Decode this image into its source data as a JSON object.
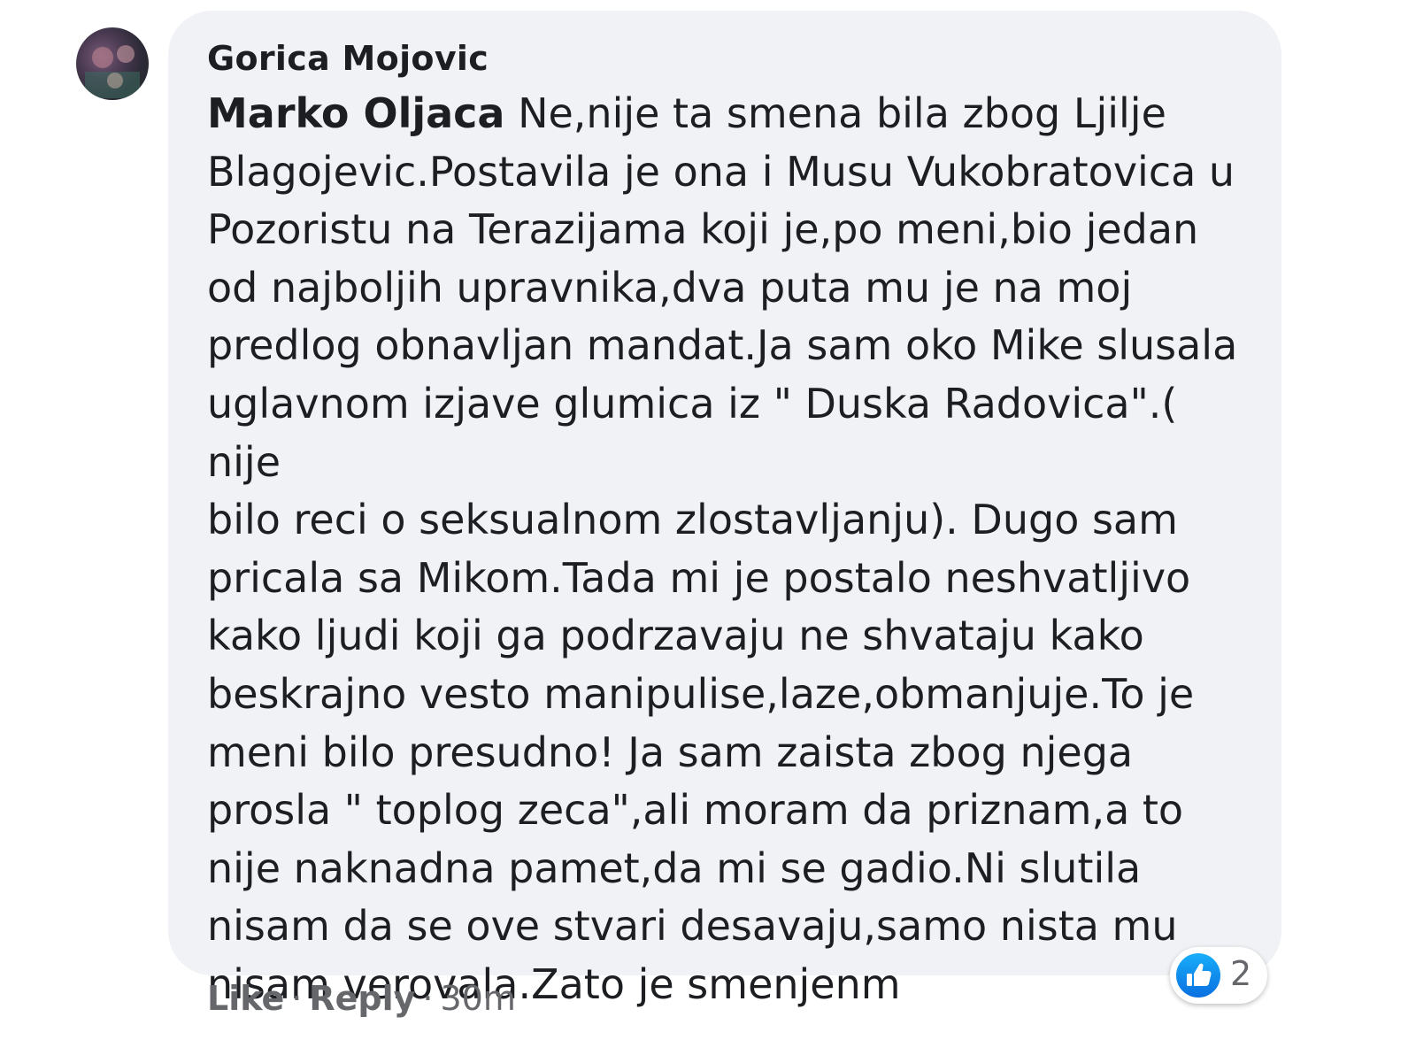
{
  "comment": {
    "author": "Gorica Mojovic",
    "mention": "Marko Oljaca",
    "lines": [
      " Ne,nije ta smena bila zbog Ljilje",
      "Blagojevic.Postavila je ona i Musu Vukobratovica u",
      "Pozoristu na Terazijama koji je,po meni,bio jedan",
      "od najboljih upravnika,dva puta mu je na moj",
      "predlog obnavljan mandat.Ja sam oko Mike slusala",
      "uglavnom izjave glumica iz \" Duska Radovica\".( nije",
      "bilo reci o seksualnom zlostavljanju). Dugo sam",
      "pricala sa Mikom.Tada mi je postalo neshvatljivo",
      "kako ljudi koji ga podrzavaju ne shvataju kako",
      "beskrajno vesto manipulise,laze,obmanjuje.To je",
      "meni bilo presudno! Ja sam zaista zbog njega",
      "prosla \" toplog zeca\",ali moram da priznam,a to",
      "nije naknadna pamet,da mi se gadio.Ni slutila",
      "nisam da se ove stvari desavaju,samo nista mu",
      "nisam verovala.Zato je smenjenm"
    ]
  },
  "actions": {
    "like_label": "Like",
    "separator": "·",
    "reply_label": "Reply",
    "timestamp": "30m"
  },
  "reactions": {
    "icon": "thumbs-up-icon",
    "count": "2",
    "color": "#1877f2"
  },
  "colors": {
    "bubble": "#f0f2f5",
    "text": "#1c1e21",
    "secondary": "#65676b"
  }
}
